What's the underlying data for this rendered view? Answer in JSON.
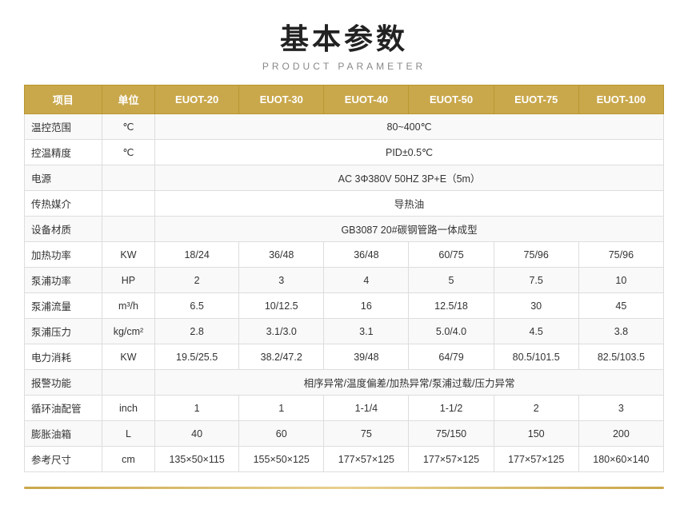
{
  "title": "基本参数",
  "subtitle": "PRODUCT PARAMETER",
  "table": {
    "headers": [
      "项目",
      "单位",
      "EUOT-20",
      "EUOT-30",
      "EUOT-40",
      "EUOT-50",
      "EUOT-75",
      "EUOT-100"
    ],
    "rows": [
      {
        "item": "温控范围",
        "unit": "℃",
        "span": true,
        "spanText": "80~400℃"
      },
      {
        "item": "控温精度",
        "unit": "℃",
        "span": true,
        "spanText": "PID±0.5℃"
      },
      {
        "item": "电源",
        "unit": "",
        "span": true,
        "spanText": "AC 3Φ380V 50HZ 3P+E（5m）"
      },
      {
        "item": "传热媒介",
        "unit": "",
        "span": true,
        "spanText": "导热油"
      },
      {
        "item": "设备材质",
        "unit": "",
        "span": true,
        "spanText": "GB3087   20#碳钢管路一体成型"
      },
      {
        "item": "加热功率",
        "unit": "KW",
        "span": false,
        "values": [
          "18/24",
          "36/48",
          "36/48",
          "60/75",
          "75/96",
          "75/96"
        ]
      },
      {
        "item": "泵浦功率",
        "unit": "HP",
        "span": false,
        "values": [
          "2",
          "3",
          "4",
          "5",
          "7.5",
          "10"
        ]
      },
      {
        "item": "泵浦流量",
        "unit": "m³/h",
        "span": false,
        "values": [
          "6.5",
          "10/12.5",
          "16",
          "12.5/18",
          "30",
          "45"
        ]
      },
      {
        "item": "泵浦压力",
        "unit": "kg/cm²",
        "span": false,
        "values": [
          "2.8",
          "3.1/3.0",
          "3.1",
          "5.0/4.0",
          "4.5",
          "3.8"
        ]
      },
      {
        "item": "电力消耗",
        "unit": "KW",
        "span": false,
        "values": [
          "19.5/25.5",
          "38.2/47.2",
          "39/48",
          "64/79",
          "80.5/101.5",
          "82.5/103.5"
        ]
      },
      {
        "item": "报警功能",
        "unit": "",
        "span": true,
        "spanText": "相序异常/温度偏差/加热异常/泵浦过载/压力异常"
      },
      {
        "item": "循环油配管",
        "unit": "inch",
        "span": false,
        "values": [
          "1",
          "1",
          "1-1/4",
          "1-1/2",
          "2",
          "3"
        ]
      },
      {
        "item": "膨胀油箱",
        "unit": "L",
        "span": false,
        "values": [
          "40",
          "60",
          "75",
          "75/150",
          "150",
          "200"
        ]
      },
      {
        "item": "参考尺寸",
        "unit": "cm",
        "span": false,
        "values": [
          "135×50×115",
          "155×50×125",
          "177×57×125",
          "177×57×125",
          "177×57×125",
          "180×60×140"
        ]
      }
    ]
  }
}
